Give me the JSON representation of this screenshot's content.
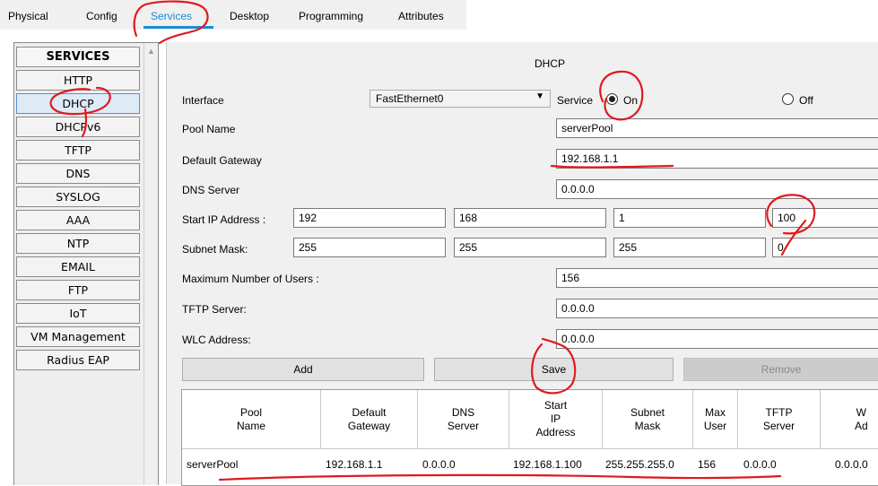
{
  "tabs": [
    "Physical",
    "Config",
    "Services",
    "Desktop",
    "Programming",
    "Attributes"
  ],
  "active_tab": "Services",
  "sidebar": {
    "header": "SERVICES",
    "items": [
      "HTTP",
      "DHCP",
      "DHCPv6",
      "TFTP",
      "DNS",
      "SYSLOG",
      "AAA",
      "NTP",
      "EMAIL",
      "FTP",
      "IoT",
      "VM Management",
      "Radius EAP"
    ],
    "selected": "DHCP"
  },
  "dhcp": {
    "title": "DHCP",
    "interface_label": "Interface",
    "interface_value": "FastEthernet0",
    "service_label": "Service",
    "on_label": "On",
    "off_label": "Off",
    "service_state": "On",
    "pool_name_label": "Pool Name",
    "pool_name_value": "serverPool",
    "default_gateway_label": "Default Gateway",
    "default_gateway_value": "192.168.1.1",
    "dns_server_label": "DNS Server",
    "dns_server_value": "0.0.0.0",
    "start_ip_label": "Start IP Address :",
    "start_ip": [
      "192",
      "168",
      "1",
      "100"
    ],
    "subnet_mask_label": "Subnet Mask:",
    "subnet_mask": [
      "255",
      "255",
      "255",
      "0"
    ],
    "max_users_label": "Maximum Number of Users :",
    "max_users_value": "156",
    "tftp_server_label": "TFTP Server:",
    "tftp_server_value": "0.0.0.0",
    "wlc_address_label": "WLC Address:",
    "wlc_address_value": "0.0.0.0",
    "add_label": "Add",
    "save_label": "Save",
    "remove_label": "Remove"
  },
  "pool_table": {
    "headers": [
      "Pool\nName",
      "Default\nGateway",
      "DNS\nServer",
      "Start\nIP\nAddress",
      "Subnet\nMask",
      "Max\nUser",
      "TFTP\nServer",
      "W\nAd"
    ],
    "rows": [
      [
        "serverPool",
        "192.168.1.1",
        "0.0.0.0",
        "192.168.1.100",
        "255.255.255.0",
        "156",
        "0.0.0.0",
        "0.0.0.0"
      ]
    ]
  },
  "colors": {
    "accent_blue": "#1e8ad6",
    "annotation_red": "#e0191e",
    "panel_bg": "#f0f0f0"
  }
}
